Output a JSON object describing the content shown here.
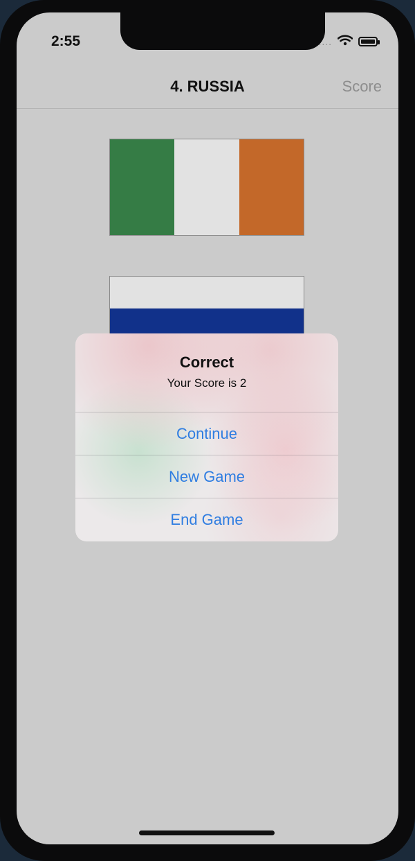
{
  "status_bar": {
    "time": "2:55",
    "dots": "....",
    "wifi_icon": "wifi-icon",
    "battery_icon": "battery-icon"
  },
  "nav": {
    "title": "4. RUSSIA",
    "score_button": "Score"
  },
  "flags": [
    {
      "name": "flag-ireland",
      "orientation": "vertical",
      "colors": [
        "#357c45",
        "#e2e2e2",
        "#c36829"
      ]
    },
    {
      "name": "flag-russia",
      "orientation": "horizontal",
      "colors": [
        "#e2e2e2",
        "#11318a",
        "#c83a31"
      ]
    }
  ],
  "alert": {
    "title": "Correct",
    "message": "Your Score is 2",
    "buttons": [
      "Continue",
      "New Game",
      "End Game"
    ]
  },
  "colors": {
    "accent": "#2f7de1",
    "screen_bg": "#cbcbcb"
  }
}
